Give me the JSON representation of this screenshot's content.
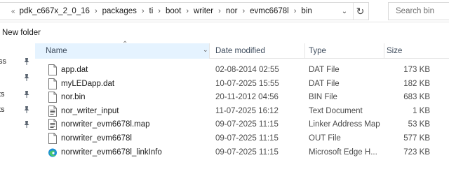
{
  "address": {
    "prefix": "«",
    "crumbs": [
      "pdk_c667x_2_0_16",
      "packages",
      "ti",
      "boot",
      "writer",
      "nor",
      "evmc6678l",
      "bin"
    ],
    "dropdown_icon": "chevron-down",
    "refresh_icon": "refresh"
  },
  "search": {
    "placeholder": "Search bin"
  },
  "toolbar": {
    "new_folder_label": "New folder"
  },
  "nav": {
    "items": [
      {
        "label": "ss",
        "pinned": true
      },
      {
        "label": "",
        "pinned": true
      },
      {
        "label": "ts",
        "pinned": true
      },
      {
        "label": "ts",
        "pinned": true
      },
      {
        "label": "",
        "pinned": true
      }
    ]
  },
  "columns": {
    "name": "Name",
    "date": "Date modified",
    "type": "Type",
    "size": "Size"
  },
  "files": [
    {
      "name": "app.dat",
      "date": "02-08-2014 02:55",
      "type": "DAT File",
      "size": "173 KB",
      "icon": "blank-file"
    },
    {
      "name": "myLEDapp.dat",
      "date": "10-07-2025 15:55",
      "type": "DAT File",
      "size": "182 KB",
      "icon": "blank-file"
    },
    {
      "name": "nor.bin",
      "date": "20-11-2012 04:56",
      "type": "BIN File",
      "size": "683 KB",
      "icon": "blank-file"
    },
    {
      "name": "nor_writer_input",
      "date": "11-07-2025 16:12",
      "type": "Text Document",
      "size": "1 KB",
      "icon": "text-file"
    },
    {
      "name": "norwriter_evm6678l.map",
      "date": "09-07-2025 11:15",
      "type": "Linker Address Map",
      "size": "53 KB",
      "icon": "text-file"
    },
    {
      "name": "norwriter_evm6678l",
      "date": "09-07-2025 11:15",
      "type": "OUT File",
      "size": "577 KB",
      "icon": "blank-file"
    },
    {
      "name": "norwriter_evm6678l_linkInfo",
      "date": "09-07-2025 11:15",
      "type": "Microsoft Edge H...",
      "size": "723 KB",
      "icon": "edge-file"
    }
  ],
  "colors": {
    "sorted_header_bg": "#e5f3ff",
    "header_text": "#3d4b5c"
  }
}
